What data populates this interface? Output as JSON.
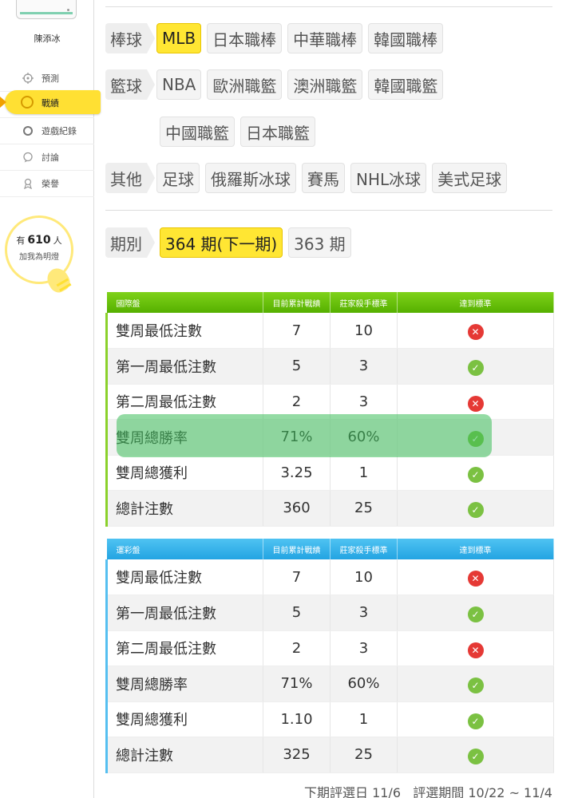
{
  "sidebar": {
    "username": "陳添冰",
    "nav": [
      {
        "label": "預測",
        "icon": "target-icon"
      },
      {
        "label": "戰績",
        "icon": "trophy-icon"
      },
      {
        "label": "遊戲紀錄",
        "icon": "circle-icon"
      },
      {
        "label": "討論",
        "icon": "chat-icon"
      },
      {
        "label": "榮譽",
        "icon": "medal-icon"
      }
    ],
    "fans": {
      "prefix": "有",
      "count": "610",
      "suffix": "人",
      "sub": "加我為明燈"
    }
  },
  "categories": [
    {
      "label": "棒球",
      "items": [
        "MLB",
        "日本職棒",
        "中華職棒",
        "韓國職棒"
      ],
      "selected": "MLB"
    },
    {
      "label": "籃球",
      "items": [
        "NBA",
        "歐洲職籃",
        "澳洲職籃",
        "韓國職籃"
      ],
      "items2": [
        "中國職籃",
        "日本職籃"
      ]
    },
    {
      "label": "其他",
      "items": [
        "足球",
        "俄羅斯冰球",
        "賽馬",
        "NHL冰球",
        "美式足球"
      ]
    }
  ],
  "period": {
    "label": "期別",
    "options": [
      "364 期(下一期)",
      "363 期"
    ],
    "selected": "364 期(下一期)"
  },
  "table_intl": {
    "headers": [
      "國際盤",
      "目前累計戰績",
      "莊家殺手標準",
      "達到標準"
    ],
    "rows": [
      {
        "name": "雙周最低注數",
        "current": "7",
        "standard": "10",
        "met": false
      },
      {
        "name": "第一周最低注數",
        "current": "5",
        "standard": "3",
        "met": true
      },
      {
        "name": "第二周最低注數",
        "current": "2",
        "standard": "3",
        "met": false
      },
      {
        "name": "雙周總勝率",
        "current": "71%",
        "standard": "60%",
        "met": true
      },
      {
        "name": "雙周總獲利",
        "current": "3.25",
        "standard": "1",
        "met": true
      },
      {
        "name": "總計注數",
        "current": "360",
        "standard": "25",
        "met": true
      }
    ]
  },
  "table_lottery": {
    "headers": [
      "運彩盤",
      "目前累計戰績",
      "莊家殺手標準",
      "達到標準"
    ],
    "rows": [
      {
        "name": "雙周最低注數",
        "current": "7",
        "standard": "10",
        "met": false
      },
      {
        "name": "第一周最低注數",
        "current": "5",
        "standard": "3",
        "met": true
      },
      {
        "name": "第二周最低注數",
        "current": "2",
        "standard": "3",
        "met": false
      },
      {
        "name": "雙周總勝率",
        "current": "71%",
        "standard": "60%",
        "met": true
      },
      {
        "name": "雙周總獲利",
        "current": "1.10",
        "standard": "1",
        "met": true
      },
      {
        "name": "總計注數",
        "current": "325",
        "standard": "25",
        "met": true
      }
    ]
  },
  "footer": {
    "next_date": "下期評選日 11/6",
    "range": "評選期間 10/22 ~ 11/4"
  },
  "colors": {
    "accent_yellow": "#ffe633",
    "intl_green": "#55b000",
    "lottery_blue": "#23a4e2",
    "ok_green": "#7bc142",
    "bad_red": "#e53935"
  }
}
